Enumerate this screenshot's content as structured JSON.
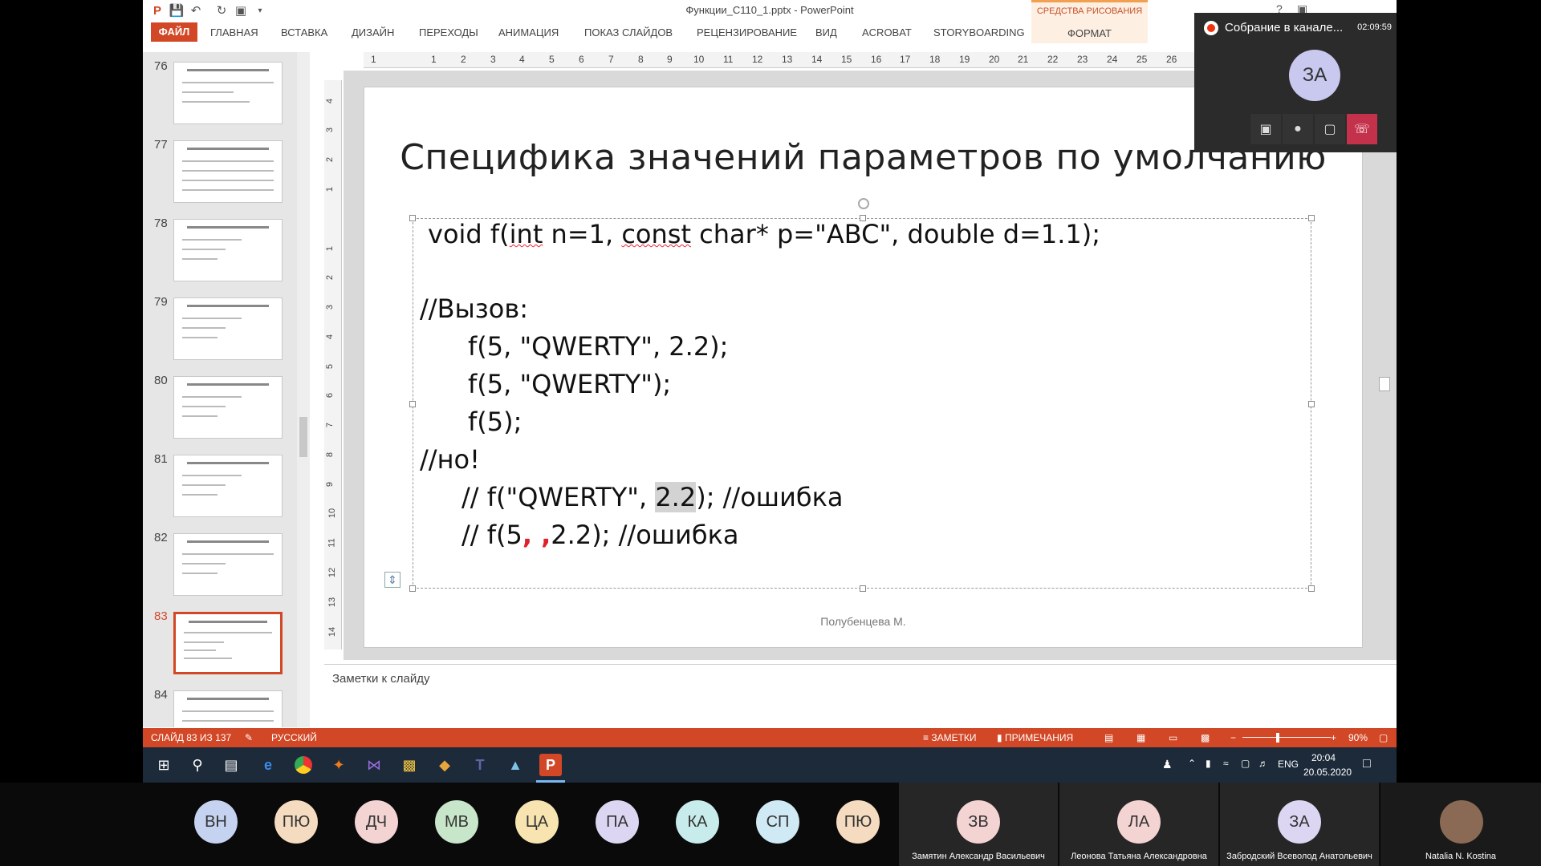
{
  "window": {
    "title": "Функции_С110_1.pptx - PowerPoint"
  },
  "ribbon": {
    "file_tab": "ФАЙЛ",
    "tabs": [
      "ГЛАВНАЯ",
      "ВСТАВКА",
      "ДИЗАЙН",
      "ПЕРЕХОДЫ",
      "АНИМАЦИЯ",
      "ПОКАЗ СЛАЙДОВ",
      "РЕЦЕНЗИРОВАНИЕ",
      "ВИД",
      "ACROBAT",
      "STORYBOARDING"
    ],
    "context_group": "СРЕДСТВА РИСОВАНИЯ",
    "context_tab": "ФОРМАТ"
  },
  "thumbnails": [
    "76",
    "77",
    "78",
    "79",
    "80",
    "81",
    "82",
    "83",
    "84"
  ],
  "ruler": {
    "h": [
      "1",
      "1",
      "2",
      "3",
      "4",
      "5",
      "6",
      "7",
      "8",
      "9",
      "10",
      "11",
      "12",
      "13",
      "14",
      "15",
      "16",
      "17",
      "18",
      "19",
      "20",
      "21",
      "22",
      "23",
      "24",
      "25",
      "26"
    ],
    "v": [
      "4",
      "3",
      "2",
      "1",
      "1",
      "2",
      "3",
      "4",
      "5",
      "6",
      "7",
      "8",
      "9",
      "10",
      "11",
      "12",
      "13",
      "14"
    ]
  },
  "slide": {
    "title": "Специфика значений параметров по умолчанию",
    "code": {
      "l1_a": "void f(",
      "l1_b": "int",
      "l1_c": " n=1, ",
      "l1_d": "const",
      "l1_e": " char* p=\"ABC\", double d=1.1);",
      "l2": "//Вызов:",
      "l3": "f(5, \"QWERTY\", 2.2);",
      "l4": "f(5, \"QWERTY\");",
      "l5": "f(5);",
      "l6": "//но!",
      "l7_a": "// f(\"QWERTY\", ",
      "l7_b": "2.2",
      "l7_c": "); //ошибка",
      "l8_a": "// f(5",
      "l8_b": ", ,",
      "l8_c": "2.2); //ошибка"
    },
    "footer": "Полубенцева М."
  },
  "notes_placeholder": "Заметки к слайду",
  "statusbar": {
    "slide_info": "СЛАЙД 83 ИЗ 137",
    "language": "РУССКИЙ",
    "notes": "ЗАМЕТКИ",
    "comments": "ПРИМЕЧАНИЯ",
    "zoom": "90%"
  },
  "taskbar": {
    "lang": "ENG",
    "time": "20:04",
    "date": "20.05.2020"
  },
  "meeting": {
    "title": "Собрание в канале...",
    "time": "02:09:59",
    "avatar": "ЗА"
  },
  "participants": [
    {
      "initials": "ВН",
      "color": "#c5d3f0"
    },
    {
      "initials": "ПЮ",
      "color": "#f5dcc0"
    },
    {
      "initials": "ДЧ",
      "color": "#f4d3d3"
    },
    {
      "initials": "МВ",
      "color": "#c8e6c9"
    },
    {
      "initials": "ЦА",
      "color": "#f7e4b0"
    },
    {
      "initials": "ПА",
      "color": "#dcd6f2"
    },
    {
      "initials": "КА",
      "color": "#c8ecec"
    },
    {
      "initials": "СП",
      "color": "#cfe9f5"
    },
    {
      "initials": "ПЮ",
      "color": "#f5dcc0"
    }
  ],
  "named_participants": [
    {
      "initials": "ЗВ",
      "name": "Замятин Александр Васильевич",
      "color": "#f4d3d3"
    },
    {
      "initials": "ЛА",
      "name": "Леонова Татьяна Александровна",
      "color": "#f4d3d3"
    },
    {
      "initials": "ЗА",
      "name": "Забродский Всеволод Анатольевич",
      "color": "#dcd6f2"
    },
    {
      "initials": "",
      "name": "Natalia N. Kostina",
      "color": "#8a6a55"
    }
  ]
}
